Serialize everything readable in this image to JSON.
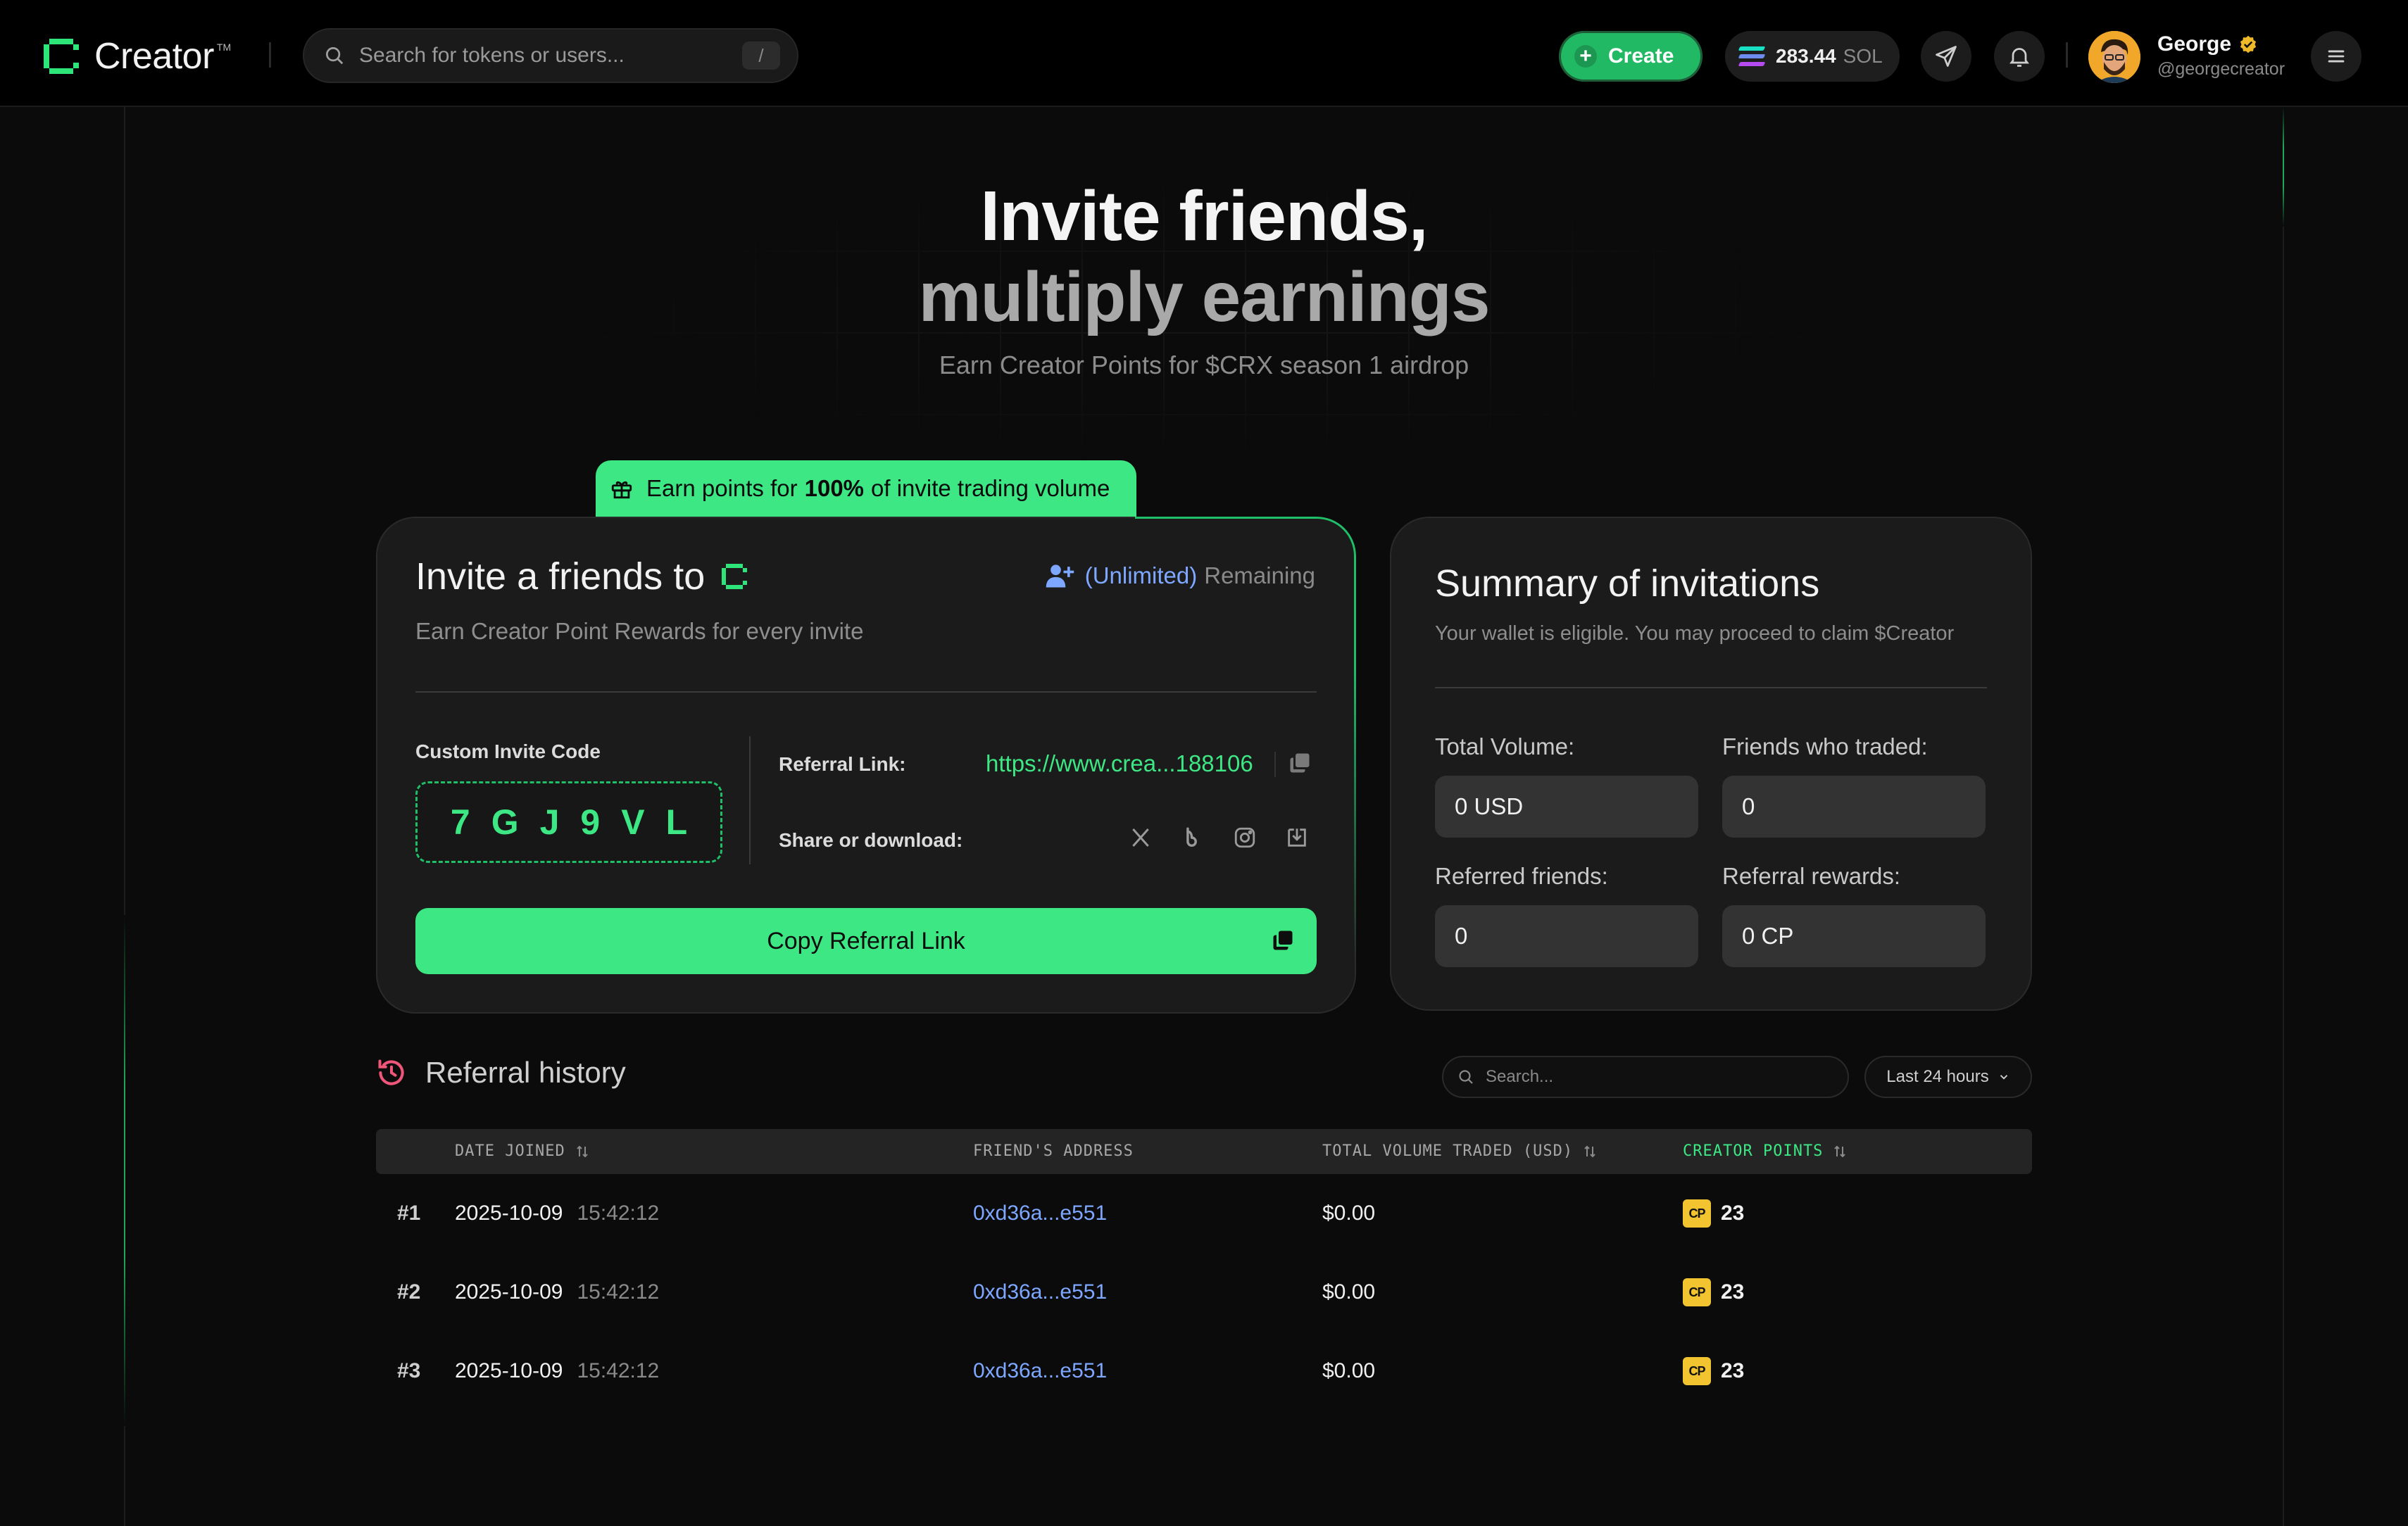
{
  "header": {
    "brand": "Creator",
    "brand_tm": "TM",
    "search_placeholder": "Search for tokens or users...",
    "search_shortcut": "/",
    "create_label": "Create",
    "balance_amount": "283.44",
    "balance_currency": "SOL",
    "user_name": "George",
    "user_handle": "@georgecreator"
  },
  "hero": {
    "line1": "Invite friends,",
    "line2": "multiply earnings",
    "subtitle": "Earn Creator Points for $CRX season 1 airdrop"
  },
  "badge": {
    "prefix": "Earn points for",
    "highlight": "100%",
    "suffix": "of invite trading volume"
  },
  "invite": {
    "title": "Invite a friends to",
    "remaining_value": "(Unlimited)",
    "remaining_label": "Remaining",
    "subtitle": "Earn Creator Point Rewards for every invite",
    "code_label": "Custom Invite Code",
    "code_chars": [
      "7",
      "G",
      "J",
      "9",
      "V",
      "L"
    ],
    "referral_label": "Referral Link:",
    "referral_link": "https://www.crea...188106",
    "share_label": "Share or download:",
    "copy_button": "Copy Referral Link"
  },
  "summary": {
    "title": "Summary of invitations",
    "subtitle": "Your wallet is eligible. You may proceed to claim $Creator",
    "stats": [
      {
        "label": "Total Volume:",
        "value": "0 USD"
      },
      {
        "label": "Friends who traded:",
        "value": "0"
      },
      {
        "label": "Referred friends:",
        "value": "0"
      },
      {
        "label": "Referral rewards:",
        "value": "0 CP"
      }
    ]
  },
  "history": {
    "title": "Referral history",
    "search_placeholder": "Search...",
    "range": "Last 24 hours",
    "columns": [
      "DATE JOINED",
      "FRIEND'S ADDRESS",
      "TOTAL VOLUME TRADED (USD)",
      "CREATOR POINTS"
    ],
    "cp_badge": "CP",
    "rows": [
      {
        "rank": "#1",
        "date": "2025-10-09",
        "time": "15:42:12",
        "address": "0xd36a...e551",
        "volume": "$0.00",
        "points": "23"
      },
      {
        "rank": "#2",
        "date": "2025-10-09",
        "time": "15:42:12",
        "address": "0xd36a...e551",
        "volume": "$0.00",
        "points": "23"
      },
      {
        "rank": "#3",
        "date": "2025-10-09",
        "time": "15:42:12",
        "address": "0xd36a...e551",
        "volume": "$0.00",
        "points": "23"
      }
    ]
  },
  "colors": {
    "accent": "#3de884",
    "link_blue": "#7ea7ff",
    "background": "#0b0b0b",
    "card": "#1b1b1b"
  }
}
